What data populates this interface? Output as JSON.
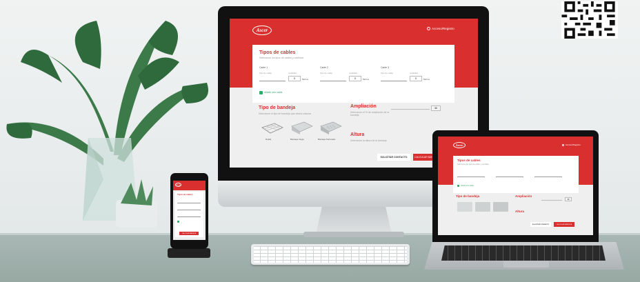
{
  "brand": {
    "logo_text": "Ascer",
    "accent": "#d9302f",
    "success": "#2eaa6a"
  },
  "header": {
    "login_label": "Acceso/Registro",
    "user_icon": "user-icon"
  },
  "cables": {
    "title": "Tipos de cables",
    "subtitle": "Seleccione los tipos de cables y cantidad",
    "groups": [
      {
        "label": "Cable 1",
        "type_label": "Tipo de cable",
        "type_placeholder": "Escoja tipo de cable",
        "qty_label": "Cantidad",
        "qty_value": "0",
        "unit": "Metros"
      },
      {
        "label": "Cable 2",
        "type_label": "Tipo de cable",
        "type_placeholder": "Escoja tipo de cable",
        "qty_label": "Cantidad",
        "qty_value": "0",
        "unit": "Metros"
      },
      {
        "label": "Cable 3",
        "type_label": "Tipo de cable",
        "type_placeholder": "Escoja tipo de cable",
        "qty_label": "Cantidad",
        "qty_value": "0",
        "unit": "Metros"
      }
    ],
    "add_label": "Añadir otro cable"
  },
  "bandeja": {
    "title": "Tipo de bandeja",
    "subtitle": "Seleccione el tipo de bandeja que desea calcular",
    "options": [
      "Rejilla",
      "Bandeja Ciega",
      "Bandeja Perforada"
    ]
  },
  "ampliacion": {
    "title": "Ampliación",
    "subtitle": "Seleccione el % de ampliación de la bandeja",
    "value": "30"
  },
  "altura": {
    "title": "Altura",
    "subtitle": "Seleccione la altura de la bandeja"
  },
  "actions": {
    "secondary": "SOLICITAR CONTACTO",
    "primary": "CALCULAR BANDEJA"
  }
}
